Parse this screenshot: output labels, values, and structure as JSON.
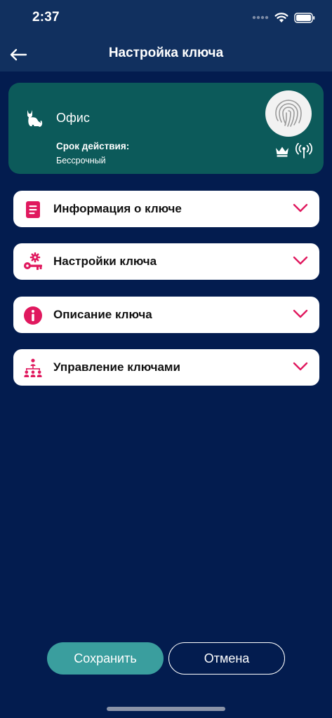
{
  "status_bar": {
    "time": "2:37",
    "icons": [
      "cellular-dots-icon",
      "wifi-icon",
      "battery-icon"
    ]
  },
  "header": {
    "title": "Настройка ключа",
    "back_icon": "arrow-left-icon"
  },
  "key_card": {
    "name": "Офис",
    "type_icon": "cat-icon",
    "validity_label": "Срок действия:",
    "validity_value": "Бессрочный",
    "badge_icons": [
      "fingerprint-icon",
      "crown-icon",
      "nfc-antenna-icon"
    ],
    "background_color": "#0c5a5a"
  },
  "sections": [
    {
      "label": "Информация о ключе",
      "icon": "document-icon"
    },
    {
      "label": "Настройки ключа",
      "icon": "key-gear-icon"
    },
    {
      "label": "Описание ключа",
      "icon": "info-icon"
    },
    {
      "label": "Управление ключами",
      "icon": "hierarchy-icon"
    }
  ],
  "buttons": {
    "save_label": "Сохранить",
    "cancel_label": "Отмена"
  },
  "colors": {
    "background": "#031c4f",
    "header": "#11305f",
    "accent": "#e0185e",
    "primary_button": "#3a9e9e"
  }
}
